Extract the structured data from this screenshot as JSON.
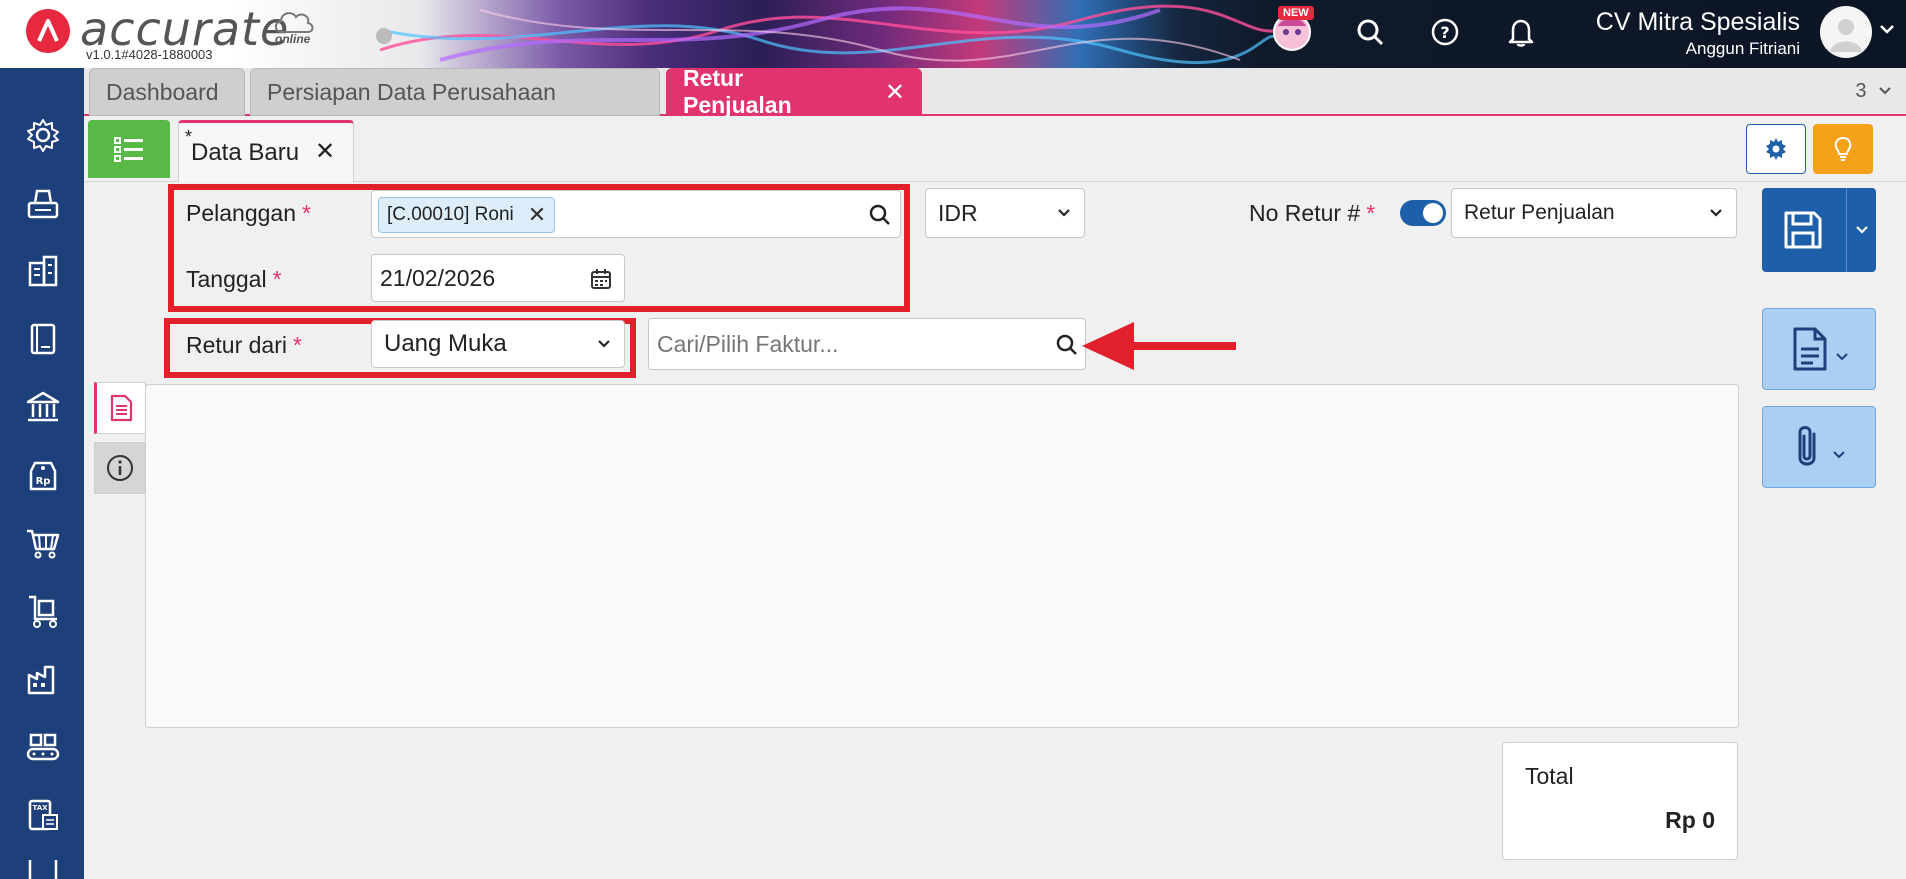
{
  "app": {
    "logo_text": "accurate",
    "logo_online": "online",
    "version": "v1.0.1#4028-1880003",
    "new_badge": "NEW",
    "company_name": "CV Mitra Spesialis",
    "user_name": "Anggun Fitriani"
  },
  "tabs": [
    {
      "label": "Dashboard"
    },
    {
      "label": "Persiapan Data Perusahaan"
    },
    {
      "label": "Retur Penjualan",
      "close": "✕"
    }
  ],
  "tab_count": "3",
  "subtab": {
    "star": "*",
    "label": "Data Baru",
    "close": "✕"
  },
  "form": {
    "pelanggan_label": "Pelanggan",
    "required_mark": "*",
    "pelanggan_chip": "[C.00010] Roni",
    "chip_close": "✕",
    "tanggal_label": "Tanggal",
    "tanggal_value": "21/02/2026",
    "currency_value": "IDR",
    "no_retur_label": "No Retur #",
    "no_retur_value": "Retur Penjualan",
    "retur_dari_label": "Retur dari",
    "retur_dari_value": "Uang Muka",
    "faktur_placeholder": "Cari/Pilih Faktur..."
  },
  "total": {
    "label": "Total",
    "value": "Rp 0"
  },
  "colors": {
    "accent": "#e0336f",
    "primary": "#1d5fa8",
    "sidebar": "#1d3f7a",
    "highlight": "#e0202a"
  },
  "sidebar_icons": [
    "gear-icon",
    "fax-icon",
    "building-icon",
    "book-icon",
    "bank-icon",
    "price-tag-icon",
    "cart-icon",
    "hand-truck-icon",
    "factory-icon",
    "conveyor-icon",
    "tax-icon"
  ]
}
